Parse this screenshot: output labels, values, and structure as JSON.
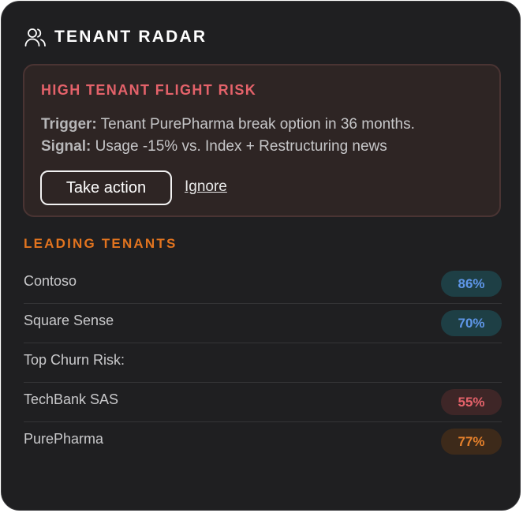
{
  "header": {
    "title": "TENANT RADAR",
    "icon": "users-icon"
  },
  "alert": {
    "title": "HIGH TENANT FLIGHT RISK",
    "trigger_label": "Trigger:",
    "trigger_text": "Tenant PurePharma break option in 36 months.",
    "signal_label": "Signal:",
    "signal_text": "Usage -15% vs. Index + Restructuring news",
    "action_label": "Take action",
    "ignore_label": "Ignore",
    "accent_color": "#e4626a"
  },
  "leading": {
    "title": "LEADING TENANTS",
    "rows": [
      {
        "label": "Contoso",
        "value": "86%",
        "tone": "blue"
      },
      {
        "label": "Square Sense",
        "value": "70%",
        "tone": "blue"
      },
      {
        "label": "Top Churn Risk:",
        "value": null,
        "tone": null
      },
      {
        "label": "TechBank SAS",
        "value": "55%",
        "tone": "red"
      },
      {
        "label": "PurePharma",
        "value": "77%",
        "tone": "orange"
      }
    ]
  },
  "colors": {
    "blue": "#5e96e8",
    "red": "#e4626a",
    "orange": "#e5802b",
    "section": "#e2741f"
  }
}
